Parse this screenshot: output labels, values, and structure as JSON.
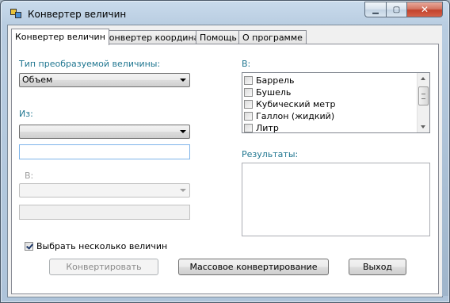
{
  "window": {
    "title": "Конвертер величин",
    "min_symbol": "▁",
    "max_symbol": "▢",
    "close_symbol": "✕"
  },
  "tabs": [
    {
      "label": "Конвертер величин",
      "active": true
    },
    {
      "label": "Конвертер координат",
      "active": false
    },
    {
      "label": "Помощь",
      "active": false
    },
    {
      "label": "О программе",
      "active": false
    }
  ],
  "converter": {
    "type_label": "Тип преобразуемой величины:",
    "type_value": "Объем",
    "from_label": "Из:",
    "from_value": "",
    "from_input_value": "",
    "to_label": "В:",
    "to_value": "",
    "to_input_value": "",
    "multi_to_label": "В:",
    "multi_items": [
      {
        "label": "Баррель",
        "checked": false
      },
      {
        "label": "Бушель",
        "checked": false
      },
      {
        "label": "Кубический метр",
        "checked": false
      },
      {
        "label": "Галлон (жидкий)",
        "checked": false
      },
      {
        "label": "Литр",
        "checked": false
      }
    ],
    "results_label": "Результаты:",
    "results_value": "",
    "multi_select_label": "Выбрать несколько величин",
    "multi_select_checked": true
  },
  "buttons": {
    "convert": "Конвертировать",
    "mass_convert": "Массовое конвертирование",
    "exit": "Выход"
  },
  "colors": {
    "label_teal": "#217791",
    "disabled_gray": "#a0a0a0"
  }
}
